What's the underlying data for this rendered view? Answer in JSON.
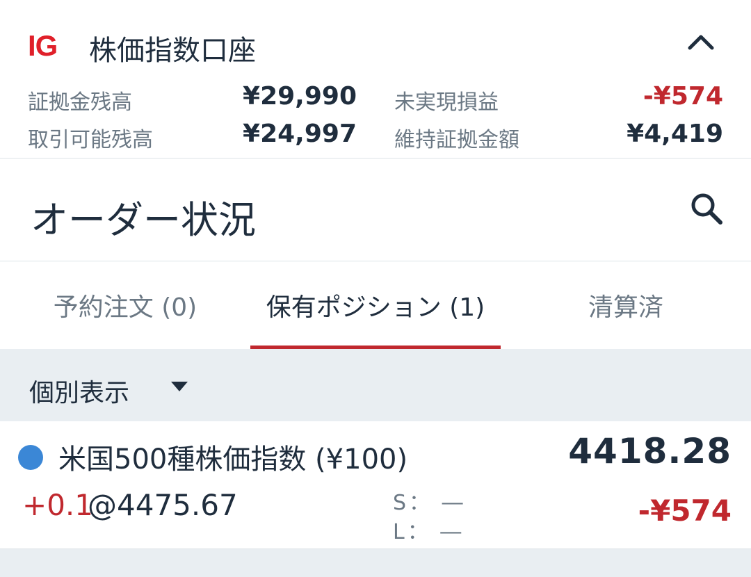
{
  "account": {
    "logo": "IG",
    "title": "株価指数口座",
    "stats": [
      {
        "label": "証拠金残高",
        "value": "¥29,990"
      },
      {
        "label": "取引可能残高",
        "value": "¥24,997"
      },
      {
        "label": "未実現損益",
        "value": "-¥574"
      },
      {
        "label": "維持証拠金額",
        "value": "¥4,419"
      }
    ]
  },
  "header": {
    "title": "オーダー状況"
  },
  "tabs": [
    {
      "label": "予約注文 (0)"
    },
    {
      "label": "保有ポジション (1)"
    },
    {
      "label": "清算済"
    }
  ],
  "filter": {
    "label": "個別表示"
  },
  "positions": [
    {
      "instrument": "米国500種株価指数 (¥100)",
      "current_price": "4418.28",
      "size": "+0.1",
      "open_level": "@4475.67",
      "stop": "S：  ―",
      "limit": "L：  ―",
      "pnl": "-¥574",
      "dot_color": "#3b87d6"
    }
  ],
  "colors": {
    "negative": "#c0282e",
    "brand": "#e0202a",
    "accent_tab": "#c0282e"
  }
}
